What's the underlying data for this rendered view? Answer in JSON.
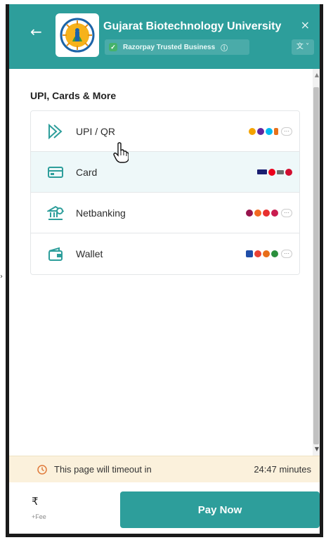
{
  "header": {
    "title": "Gujarat Biotechnology University",
    "trusted_label": "Razorpay Trusted Business",
    "back_icon": "←",
    "close_icon": "×",
    "info_icon": "ⓘ",
    "lang_icon": "文 ˅",
    "check_icon": "✓"
  },
  "colors": {
    "brand": "#2d9e9b",
    "timeout_bg": "#fbf1dc",
    "hover_bg": "#eef8f9",
    "clock": "#e07a3a"
  },
  "section": {
    "title": "UPI, Cards & More"
  },
  "methods": [
    {
      "label": "UPI / QR",
      "icon": "upi-icon"
    },
    {
      "label": "Card",
      "icon": "card-icon"
    },
    {
      "label": "Netbanking",
      "icon": "bank-icon"
    },
    {
      "label": "Wallet",
      "icon": "wallet-icon"
    }
  ],
  "more_chip": "···",
  "timeout": {
    "text": "This page will timeout in",
    "time": "24:47 minutes"
  },
  "footer": {
    "currency": "₹",
    "fee": "+Fee",
    "pay_label": "Pay Now"
  },
  "scroll": {
    "up": "▲",
    "down": "▼"
  },
  "edge_arrow": "›"
}
